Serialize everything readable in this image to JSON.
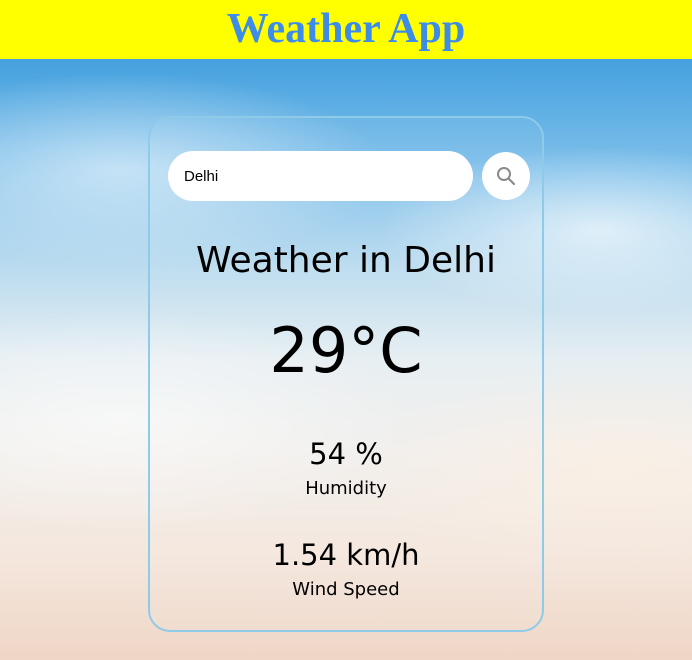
{
  "app": {
    "title": "Weather App"
  },
  "search": {
    "value": "Delhi",
    "icon": "search-icon"
  },
  "weather": {
    "heading": "Weather in Delhi",
    "temperature": "29°C",
    "humidity_value": "54 %",
    "humidity_label": "Humidity",
    "wind_value": "1.54 km/h",
    "wind_label": "Wind Speed"
  },
  "colors": {
    "header_bg": "#ffff00",
    "title_color": "#3d8ce8",
    "card_border": "#8ecbe9"
  }
}
